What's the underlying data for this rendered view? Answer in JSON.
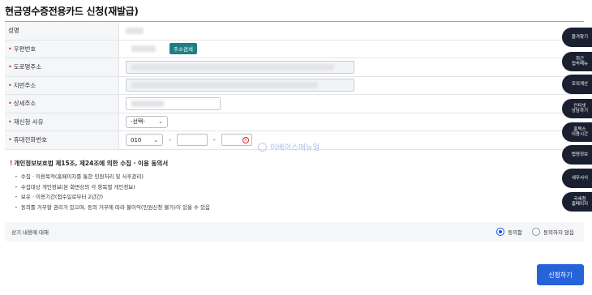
{
  "page_title": "현금영수증전용카드 신청(재발급)",
  "form": {
    "name_label": "성명",
    "postcode_label": "우편번호",
    "address_search_button": "주소검색",
    "road_address_label": "도로명주소",
    "lot_address_label": "지번주소",
    "detail_address_label": "상세주소",
    "reason_label": "재신청 사유",
    "reason_select_value": "-선택-",
    "phone_label": "휴대전화번호",
    "phone_prefix_value": "010",
    "phone_separator": "-"
  },
  "watermark_text": "이베이스매뉴얼",
  "consent": {
    "title": "개인정보보호법 제15조, 제24조에 의한 수집 · 이용 동의서",
    "items": [
      "수집 · 이용목적(홈페이지를 통한 민원처리 및 사후관리)",
      "수집대상 개인정보(본 화면상의 각 항목별 개인정보)",
      "보유 · 이용기간(접수일로부터 2년간)",
      "동의를 거부할 권리가 있으며, 동의 거부에 따라 불이익(민원신청 불가)이 있을 수 있음"
    ]
  },
  "agree": {
    "label": "상기 내용에 대해",
    "agree_option": "동의함",
    "disagree_option": "동의하지 않음",
    "selected": "agree"
  },
  "submit_button": "신청하기",
  "side_menu": [
    {
      "line1": "즐겨찾기",
      "line2": ""
    },
    {
      "line1": "최근",
      "line2": "접속메뉴"
    },
    {
      "line1": "모의계산",
      "line2": ""
    },
    {
      "line1": "인터넷",
      "line2": "상담하기"
    },
    {
      "line1": "홈택스",
      "line2": "이용시간"
    },
    {
      "line1": "법령정보",
      "line2": ""
    },
    {
      "line1": "세무서식",
      "line2": ""
    },
    {
      "line1": "국세청",
      "line2": "홈페이지"
    }
  ],
  "colors": {
    "accent_teal": "#1e7f85",
    "primary_blue": "#2563d8",
    "required_red": "#d9262c",
    "side_menu_bg": "#1b2030"
  }
}
